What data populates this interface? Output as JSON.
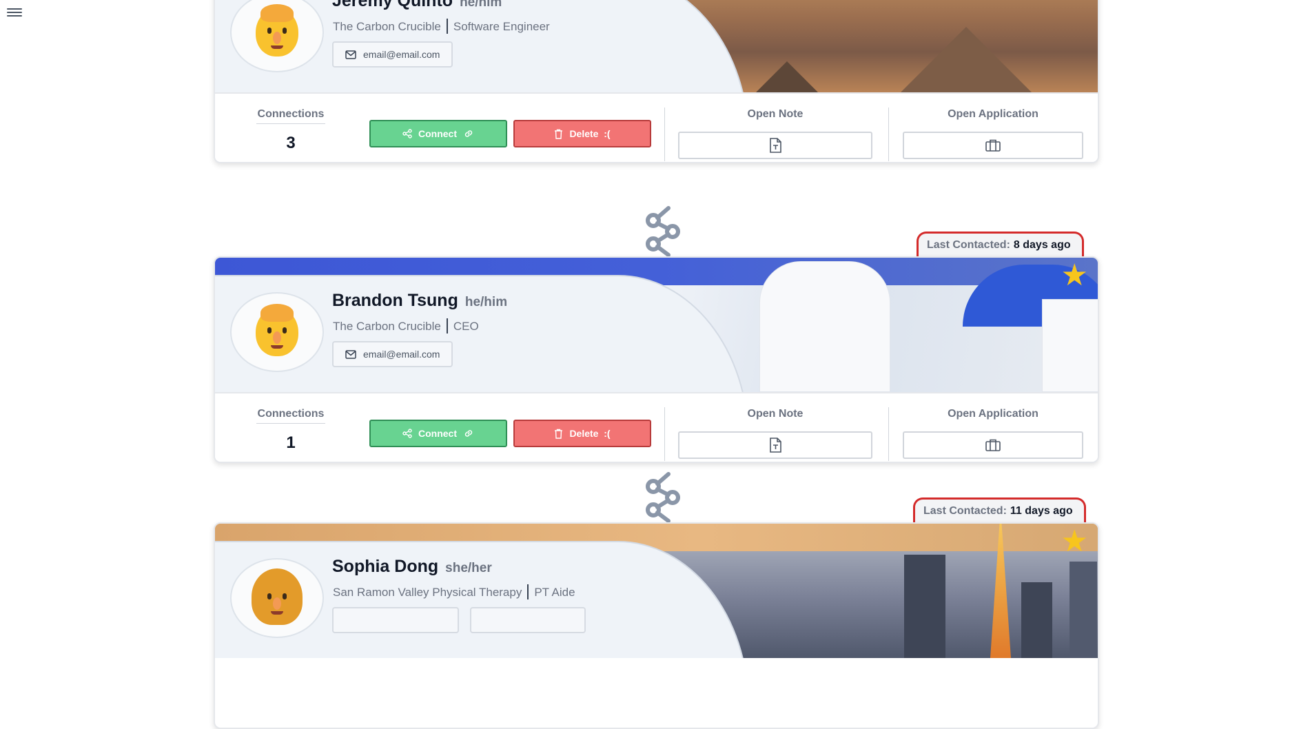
{
  "menu": {
    "icon": "hamburger-menu-icon"
  },
  "contacts": [
    {
      "name": "Jeremy Quinto",
      "pronouns": "he/him",
      "company": "The Carbon Crucible",
      "title": "Software Engineer",
      "email_label": "email@email.com",
      "connections_label": "Connections",
      "connections": "3",
      "connect_label": "Connect",
      "delete_label": "Delete  :(",
      "open_note_label": "Open Note",
      "open_application_label": "Open Application",
      "favorited": true,
      "banner_theme": "desert"
    },
    {
      "last_contacted_label": "Last Contacted:",
      "last_contacted_value": "8 days ago",
      "name": "Brandon Tsung",
      "pronouns": "he/him",
      "company": "The Carbon Crucible",
      "title": "CEO",
      "email_label": "email@email.com",
      "connections_label": "Connections",
      "connections": "1",
      "connect_label": "Connect",
      "delete_label": "Delete  :(",
      "open_note_label": "Open Note",
      "open_application_label": "Open Application",
      "favorited": true,
      "banner_theme": "santorini"
    },
    {
      "last_contacted_label": "Last Contacted:",
      "last_contacted_value": "11 days ago",
      "name": "Sophia Dong",
      "pronouns": "she/her",
      "company": "San Ramon Valley Physical Therapy",
      "title": "PT Aide",
      "favorited": true,
      "banner_theme": "tokyo"
    }
  ],
  "colors": {
    "connect": "#68d391",
    "delete": "#f27474",
    "star": "#f7c51d",
    "badge_border": "#d42b2b",
    "card_panel": "#eff3f8"
  }
}
